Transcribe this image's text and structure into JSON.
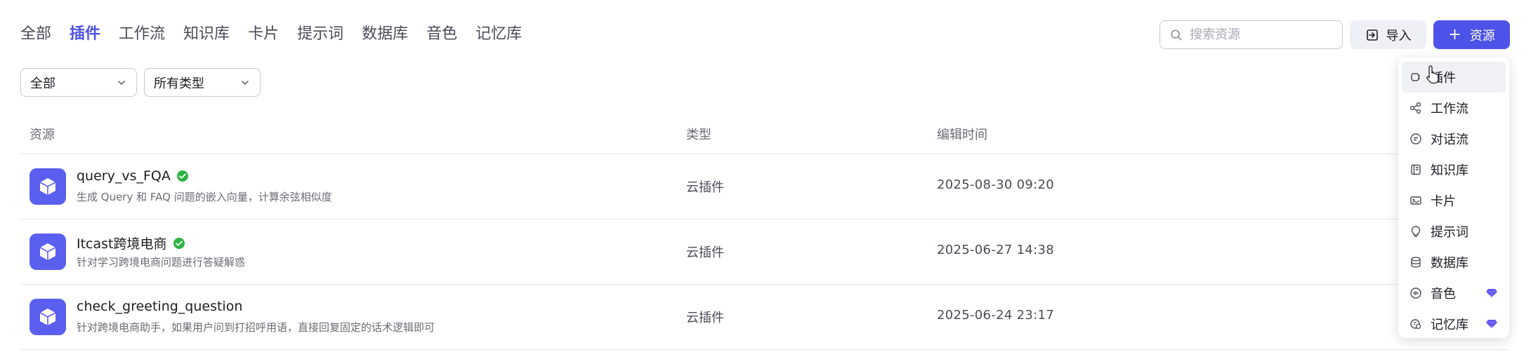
{
  "tabs": [
    {
      "label": "全部",
      "active": false
    },
    {
      "label": "插件",
      "active": true
    },
    {
      "label": "工作流",
      "active": false
    },
    {
      "label": "知识库",
      "active": false
    },
    {
      "label": "卡片",
      "active": false
    },
    {
      "label": "提示词",
      "active": false
    },
    {
      "label": "数据库",
      "active": false
    },
    {
      "label": "音色",
      "active": false
    },
    {
      "label": "记忆库",
      "active": false
    }
  ],
  "search": {
    "placeholder": "搜索资源",
    "value": ""
  },
  "toolbar": {
    "import_label": "导入",
    "resource_label": "资源",
    "resource_icon": "plus-icon",
    "import_icon": "import-icon"
  },
  "filters": {
    "scope": "全部",
    "type": "所有类型"
  },
  "table": {
    "headers": {
      "resource": "资源",
      "type": "类型",
      "edited": "编辑时间"
    },
    "rows": [
      {
        "name": "query_vs_FQA",
        "verified": true,
        "description": "生成 Query 和 FAQ 问题的嵌入向量，计算余弦相似度",
        "type": "云插件",
        "edited": "2025-08-30 09:20"
      },
      {
        "name": "Itcast跨境电商",
        "verified": true,
        "description": "针对学习跨境电商问题进行答疑解惑",
        "type": "云插件",
        "edited": "2025-06-27 14:38"
      },
      {
        "name": "check_greeting_question",
        "verified": false,
        "description": "针对跨境电商助手，如果用户问到打招呼用语，直接回复固定的话术逻辑即可",
        "type": "云插件",
        "edited": "2025-06-24 23:17"
      }
    ]
  },
  "menu": {
    "items": [
      {
        "label": "插件",
        "icon": "plugin-icon",
        "premium": false
      },
      {
        "label": "工作流",
        "icon": "workflow-icon",
        "premium": false
      },
      {
        "label": "对话流",
        "icon": "chatflow-icon",
        "premium": false
      },
      {
        "label": "知识库",
        "icon": "knowledge-icon",
        "premium": false
      },
      {
        "label": "卡片",
        "icon": "card-icon",
        "premium": false
      },
      {
        "label": "提示词",
        "icon": "prompt-icon",
        "premium": false
      },
      {
        "label": "数据库",
        "icon": "database-icon",
        "premium": false
      },
      {
        "label": "音色",
        "icon": "voice-icon",
        "premium": true
      },
      {
        "label": "记忆库",
        "icon": "memory-icon",
        "premium": true
      }
    ]
  },
  "colors": {
    "accent": "#4d53e8",
    "verified": "#2fb344",
    "premium": "#5a4ff0"
  }
}
